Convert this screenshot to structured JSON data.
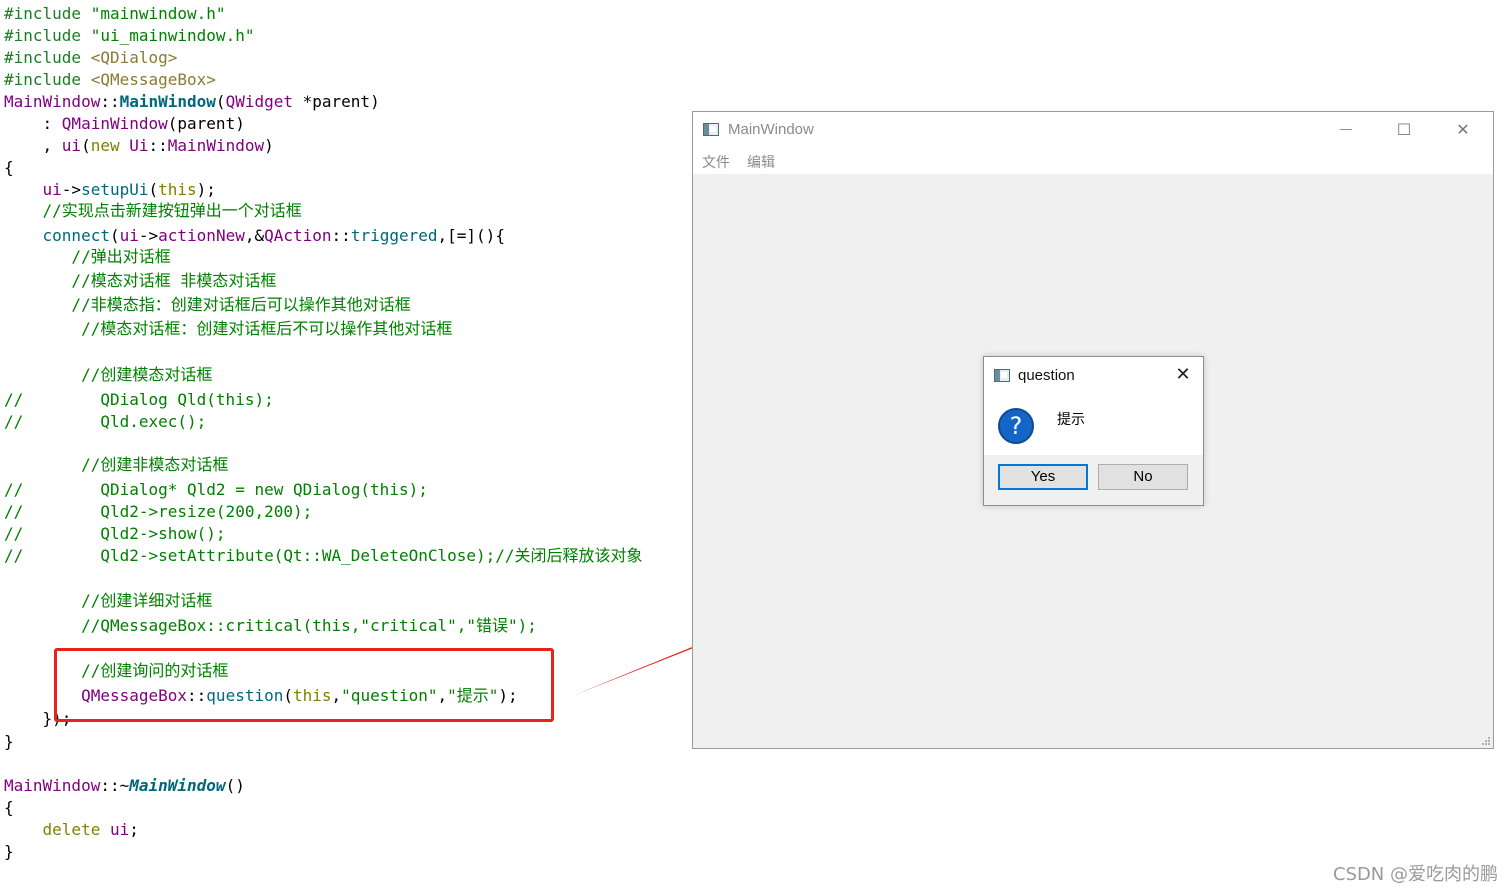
{
  "code_lines": [
    [
      [
        "#include ",
        "pre"
      ],
      [
        "\"mainwindow.h\"",
        "str"
      ]
    ],
    [
      [
        "#include ",
        "pre"
      ],
      [
        "\"ui_mainwindow.h\"",
        "str"
      ]
    ],
    [
      [
        "#include ",
        "pre"
      ],
      [
        "<QDialog>",
        "inc"
      ]
    ],
    [
      [
        "#include ",
        "pre"
      ],
      [
        "<QMessageBox>",
        "inc"
      ]
    ],
    [
      [
        "MainWindow",
        "cls"
      ],
      [
        "::",
        "plain"
      ],
      [
        "MainWindow",
        "funcb"
      ],
      [
        "(",
        "punc"
      ],
      [
        "QWidget",
        "cls"
      ],
      [
        " *parent)",
        "plain"
      ]
    ],
    [
      [
        "    : ",
        "plain"
      ],
      [
        "QMainWindow",
        "cls"
      ],
      [
        "(parent)",
        "plain"
      ]
    ],
    [
      [
        "    , ",
        "plain"
      ],
      [
        "ui",
        "cls"
      ],
      [
        "(",
        "plain"
      ],
      [
        "new",
        "kw"
      ],
      [
        " ",
        "plain"
      ],
      [
        "Ui",
        "cls"
      ],
      [
        "::",
        "plain"
      ],
      [
        "MainWindow",
        "cls"
      ],
      [
        ")",
        "plain"
      ]
    ],
    [
      [
        "{",
        "plain"
      ]
    ],
    [
      [
        "    ",
        "plain"
      ],
      [
        "ui",
        "cls"
      ],
      [
        "->",
        "plain"
      ],
      [
        "setupUi",
        "func"
      ],
      [
        "(",
        "plain"
      ],
      [
        "this",
        "kw"
      ],
      [
        ");",
        "plain"
      ]
    ],
    [
      [
        "    //实现点击新建按钮弹出一个对话框",
        "cm"
      ]
    ],
    [
      [
        "    ",
        "plain"
      ],
      [
        "connect",
        "func"
      ],
      [
        "(",
        "plain"
      ],
      [
        "ui",
        "cls"
      ],
      [
        "->",
        "plain"
      ],
      [
        "actionNew",
        "cls"
      ],
      [
        ",&",
        "plain"
      ],
      [
        "QAction",
        "cls"
      ],
      [
        "::",
        "plain"
      ],
      [
        "triggered",
        "func"
      ],
      [
        ",[=](){",
        "plain"
      ]
    ],
    [
      [
        "       //弹出对话框",
        "cm"
      ]
    ],
    [
      [
        "       //模态对话框 非模态对话框",
        "cm"
      ]
    ],
    [
      [
        "       //非模态指：创建对话框后可以操作其他对话框",
        "cm"
      ]
    ],
    [
      [
        "        //模态对话框：创建对话框后不可以操作其他对话框",
        "cm"
      ]
    ],
    [
      [
        "",
        "plain"
      ]
    ],
    [
      [
        "        //创建模态对话框",
        "cm"
      ]
    ],
    [
      [
        "//        QDialog Qld(this);",
        "cm"
      ]
    ],
    [
      [
        "//        Qld.exec();",
        "cm"
      ]
    ],
    [
      [
        "",
        "plain"
      ]
    ],
    [
      [
        "        //创建非模态对话框",
        "cm"
      ]
    ],
    [
      [
        "//        QDialog* Qld2 = new QDialog(this);",
        "cm"
      ]
    ],
    [
      [
        "//        Qld2->resize(200,200);",
        "cm"
      ]
    ],
    [
      [
        "//        Qld2->show();",
        "cm"
      ]
    ],
    [
      [
        "//        Qld2->setAttribute(Qt::WA_DeleteOnClose);//关闭后释放该对象",
        "cm"
      ]
    ],
    [
      [
        "",
        "plain"
      ]
    ],
    [
      [
        "        //创建详细对话框",
        "cm"
      ]
    ],
    [
      [
        "        //QMessageBox::critical(this,\"critical\",\"错误\");",
        "cm"
      ]
    ],
    [
      [
        "",
        "plain"
      ]
    ],
    [
      [
        "        //创建询问的对话框",
        "cm"
      ]
    ],
    [
      [
        "        ",
        "plain"
      ],
      [
        "QMessageBox",
        "cls"
      ],
      [
        "::",
        "plain"
      ],
      [
        "question",
        "func"
      ],
      [
        "(",
        "plain"
      ],
      [
        "this",
        "kw"
      ],
      [
        ",",
        "plain"
      ],
      [
        "\"question\"",
        "str"
      ],
      [
        ",",
        "plain"
      ],
      [
        "\"提示\"",
        "str"
      ],
      [
        ");",
        "plain"
      ]
    ],
    [
      [
        "    });",
        "plain"
      ]
    ],
    [
      [
        "}",
        "plain"
      ]
    ],
    [
      [
        "",
        "plain"
      ]
    ],
    [
      [
        "MainWindow",
        "cls"
      ],
      [
        "::~",
        "plain"
      ],
      [
        "MainWindow",
        "funci"
      ],
      [
        "()",
        "plain"
      ]
    ],
    [
      [
        "{",
        "plain"
      ]
    ],
    [
      [
        "    ",
        "plain"
      ],
      [
        "delete",
        "kw"
      ],
      [
        " ",
        "plain"
      ],
      [
        "ui",
        "cls"
      ],
      [
        ";",
        "plain"
      ]
    ],
    [
      [
        "}",
        "plain"
      ]
    ]
  ],
  "main_window": {
    "title": "MainWindow",
    "minimize_glyph": "—",
    "maximize_glyph": "☐",
    "close_glyph": "✕",
    "menu": [
      "文件",
      "编辑"
    ]
  },
  "message_box": {
    "title": "question",
    "close_glyph": "✕",
    "icon": "question-icon",
    "icon_glyph": "?",
    "text": "提示",
    "yes_label": "Yes",
    "no_label": "No"
  },
  "watermark": "CSDN @爱吃肉的鹏",
  "colors": {
    "highlight": "#e8221c",
    "arrow": "#e8221c",
    "question_icon": "#1565c8",
    "default_button_border": "#0078d7"
  }
}
